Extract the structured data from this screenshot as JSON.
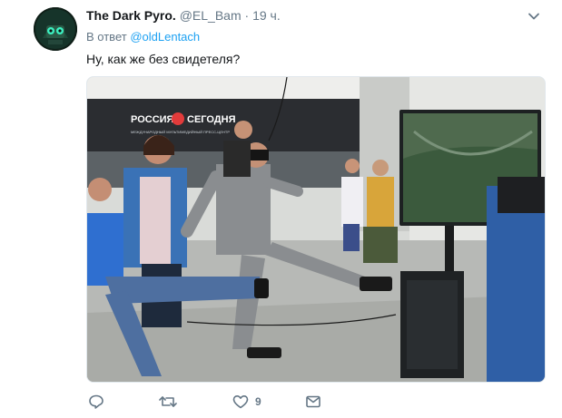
{
  "tweet": {
    "author_name": "The Dark Pyro.",
    "author_handle": "@EL_Bam",
    "separator": "·",
    "time": "19 ч.",
    "reply_prefix": "В ответ",
    "reply_mention": "@oldLentach",
    "text": "Ну, как же без свидетеля?"
  },
  "photo": {
    "sign_text": "РОССИЯ",
    "sign_text2": "СЕГОДНЯ",
    "sign_subtitle": "МЕЖДУНАРОДНЫЙ МУЛЬТИМЕДИЙНЫЙ ПРЕСС-ЦЕНТР"
  },
  "actions": {
    "reply_icon": "reply-icon",
    "retweet_icon": "retweet-icon",
    "like_icon": "heart-icon",
    "like_count": "9",
    "dm_icon": "envelope-icon"
  },
  "colors": {
    "accent": "#1da1f2",
    "secondary_text": "#657786",
    "primary_text": "#14171a"
  }
}
